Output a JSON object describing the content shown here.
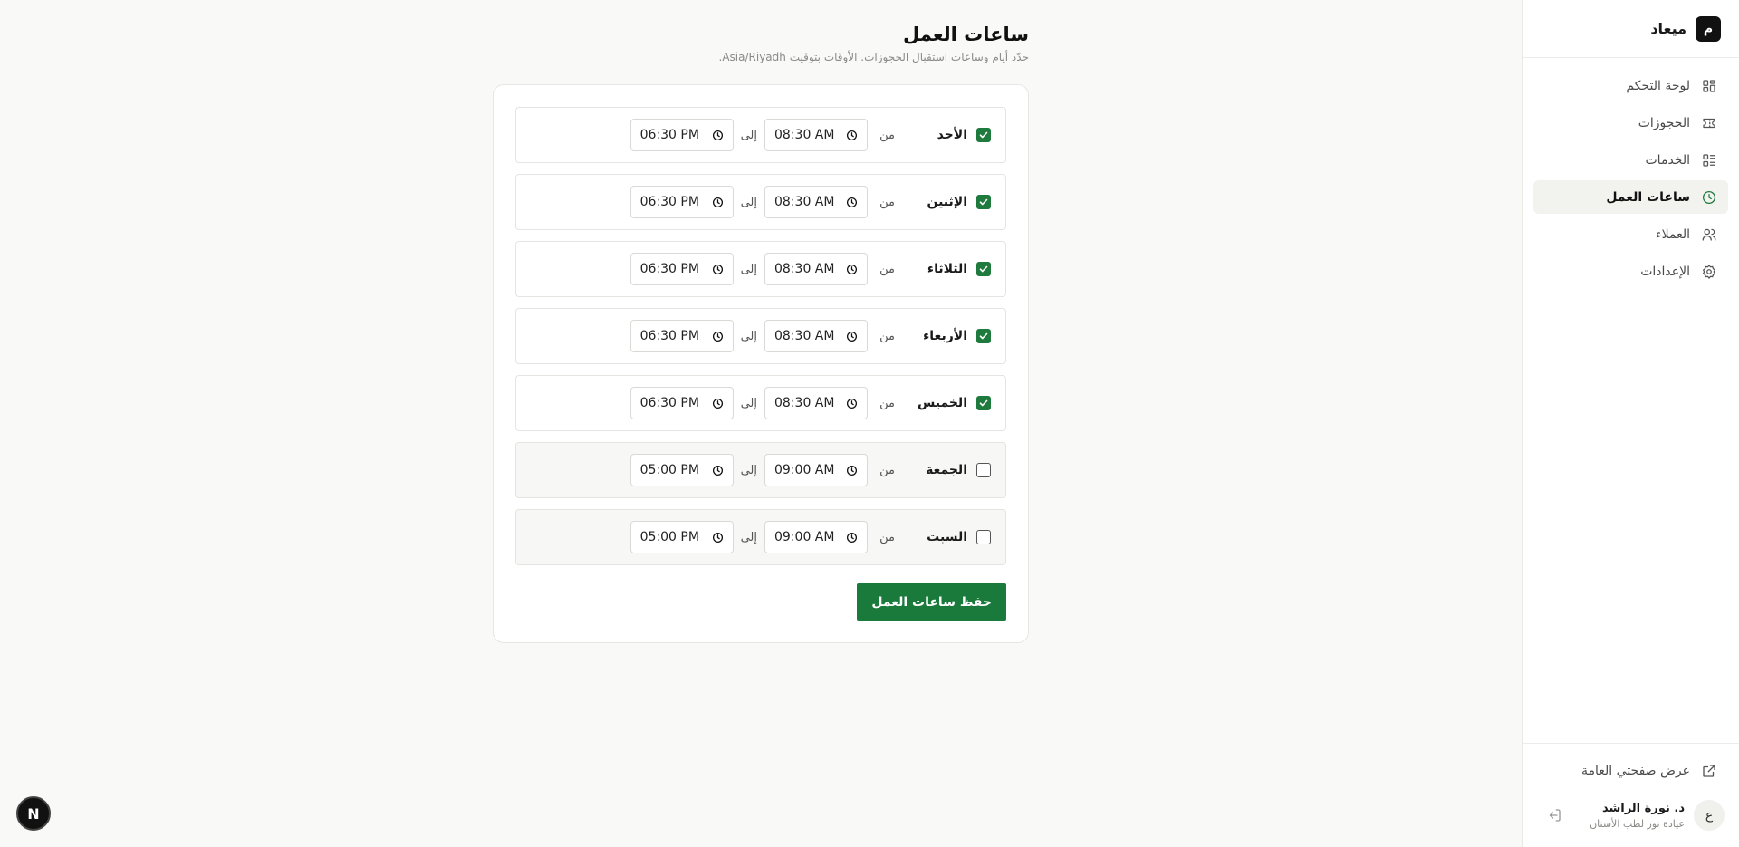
{
  "brand": {
    "logo_letter": "م",
    "name": "ميعاد"
  },
  "nav": {
    "items": [
      {
        "label": "لوحة التحكم",
        "icon": "dashboard-grid-icon",
        "active": false
      },
      {
        "label": "الحجوزات",
        "icon": "ticket-icon",
        "active": false
      },
      {
        "label": "الخدمات",
        "icon": "list-icon",
        "active": false
      },
      {
        "label": "ساعات العمل",
        "icon": "clock-icon",
        "active": true
      },
      {
        "label": "العملاء",
        "icon": "users-icon",
        "active": false
      },
      {
        "label": "الإعدادات",
        "icon": "gear-icon",
        "active": false
      }
    ]
  },
  "footer": {
    "public_link": "عرض صفحتي العامة",
    "user_initial": "ع",
    "user_name": "د. نورة الراشد",
    "user_sub": "عيادة نور لطب الأسنان"
  },
  "page": {
    "title": "ساعات العمل",
    "subtitle": "حدّد أيام وساعات استقبال الحجوزات. الأوقات بتوقيت Asia/Riyadh."
  },
  "labels": {
    "from": "من",
    "to": "إلى"
  },
  "days": [
    {
      "name": "الأحد",
      "enabled": true,
      "from": "08:30 AM",
      "to": "06:30 PM"
    },
    {
      "name": "الإثنين",
      "enabled": true,
      "from": "08:30 AM",
      "to": "06:30 PM"
    },
    {
      "name": "الثلاثاء",
      "enabled": true,
      "from": "08:30 AM",
      "to": "06:30 PM"
    },
    {
      "name": "الأربعاء",
      "enabled": true,
      "from": "08:30 AM",
      "to": "06:30 PM"
    },
    {
      "name": "الخميس",
      "enabled": true,
      "from": "08:30 AM",
      "to": "06:30 PM"
    },
    {
      "name": "الجمعة",
      "enabled": false,
      "from": "09:00 AM",
      "to": "05:00 PM"
    },
    {
      "name": "السبت",
      "enabled": false,
      "from": "09:00 AM",
      "to": "05:00 PM"
    }
  ],
  "save_label": "حفظ ساعات العمل",
  "dev_badge": "N",
  "colors": {
    "accent": "#1f7a3d",
    "background": "#f9f9f7"
  }
}
